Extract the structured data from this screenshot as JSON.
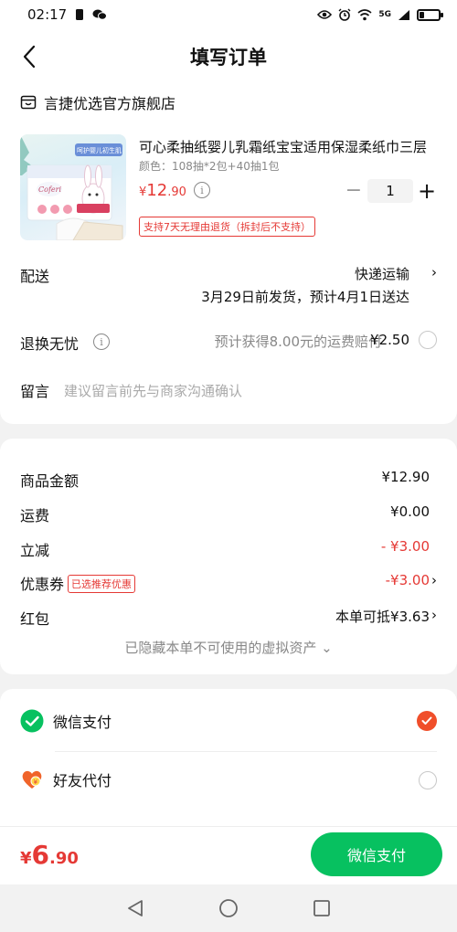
{
  "status_bar": {
    "time": "02:17",
    "network": "5G"
  },
  "header": {
    "title": "填写订单"
  },
  "store": {
    "name": "言捷优选官方旗舰店"
  },
  "product": {
    "name": "可心柔抽纸婴儿乳霜纸宝宝适用保湿柔纸巾三层",
    "spec": "颜色：108抽*2包+40抽1包",
    "price_symbol": "¥",
    "price_int": "12",
    "price_dec": ".90",
    "quantity": "1",
    "refund_tag": "支持7天无理由退货（拆封后不支持）",
    "image_texts": [
      "呵护婴儿初生肌",
      "Coferi"
    ]
  },
  "delivery": {
    "label": "配送",
    "method": "快递运输",
    "detail": "3月29日前发货，预计4月1日送达"
  },
  "return_insurance": {
    "label": "退换无忧",
    "desc": "预计获得8.00元的运费赔付",
    "price": "¥2.50"
  },
  "message": {
    "label": "留言",
    "placeholder": "建议留言前先与商家沟通确认"
  },
  "summary": {
    "goods": {
      "label": "商品金额",
      "value": "¥12.90"
    },
    "shipping": {
      "label": "运费",
      "value": "¥0.00"
    },
    "discount": {
      "label": "立减",
      "value": "- ¥3.00"
    },
    "coupon": {
      "label": "优惠券",
      "tag": "已选推荐优惠",
      "value": "-¥3.00"
    },
    "red_packet": {
      "label": "红包",
      "value": "本单可抵¥3.63"
    },
    "hidden_assets": "已隐藏本单不可使用的虚拟资产 ⌄"
  },
  "payment": {
    "wechat": {
      "label": "微信支付",
      "selected": true
    },
    "friend": {
      "label": "好友代付",
      "selected": false
    }
  },
  "bottom": {
    "total_symbol": "¥",
    "total_int": "6",
    "total_dec": ".90",
    "pay_button": "微信支付"
  },
  "colors": {
    "accent_red": "#e53935",
    "wechat_green": "#07c160",
    "check_orange": "#f04e2a"
  }
}
